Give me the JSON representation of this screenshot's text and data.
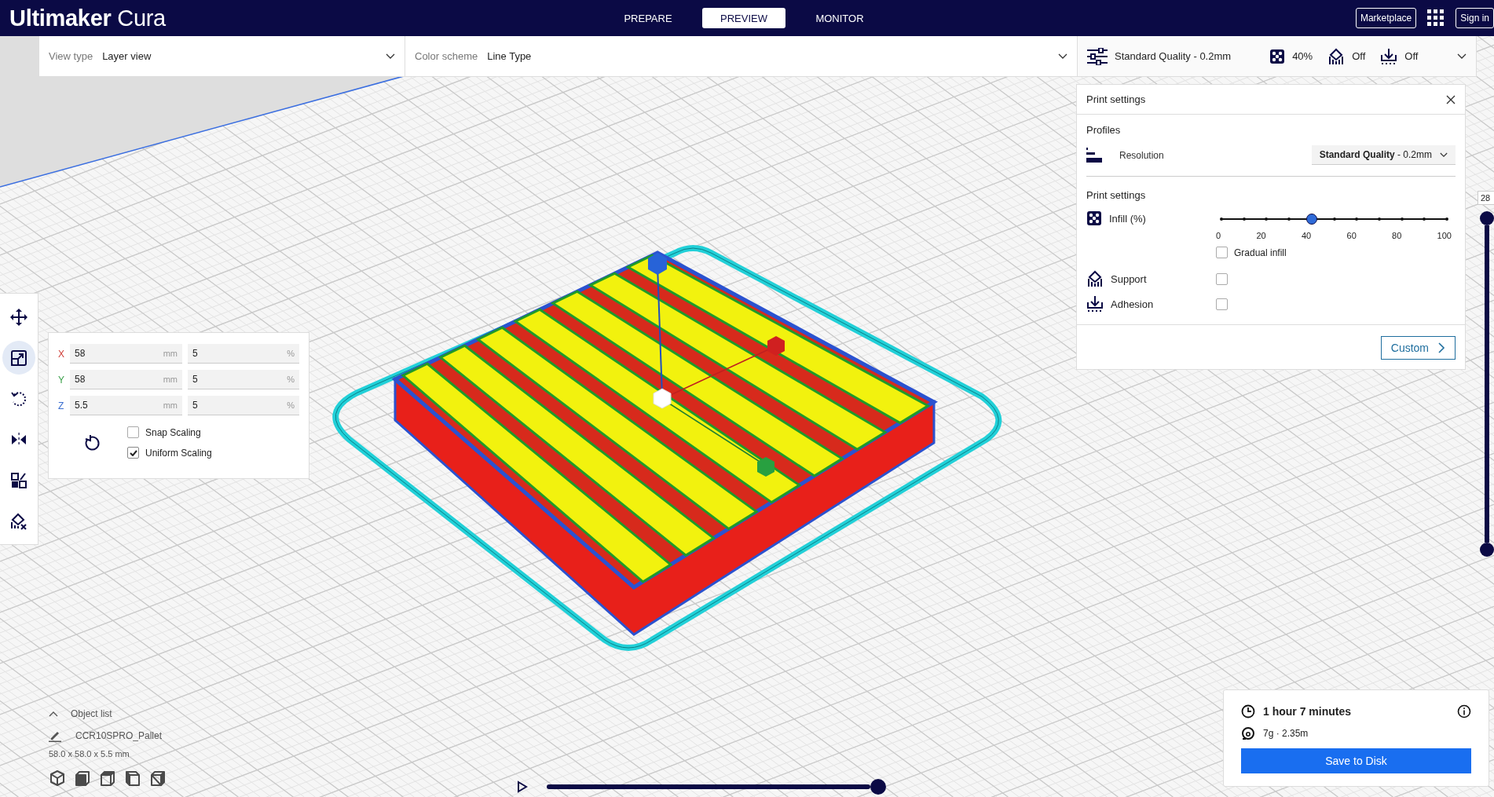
{
  "app": {
    "logo_bold": "Ultimaker",
    "logo_light": "Cura"
  },
  "stages": [
    {
      "label": "PREPARE",
      "selected": false
    },
    {
      "label": "PREVIEW",
      "selected": true
    },
    {
      "label": "MONITOR",
      "selected": false
    }
  ],
  "header_actions": {
    "marketplace": "Marketplace",
    "sign_in": "Sign in"
  },
  "view_type": {
    "label": "View type",
    "value": "Layer view"
  },
  "color_scheme": {
    "label": "Color scheme",
    "value": "Line Type"
  },
  "print_setup_summary": {
    "profile": "Standard Quality - 0.2mm",
    "infill": "40%",
    "support": "Off",
    "adhesion": "Off"
  },
  "print_settings_panel": {
    "title": "Print settings",
    "profiles_heading": "Profiles",
    "resolution_label": "Resolution",
    "resolution_value": "**Standard Quality** - 0.2mm",
    "settings_heading": "Print settings",
    "infill": {
      "label": "Infill (%)",
      "level": 0.4,
      "ticks": [
        "0",
        "20",
        "40",
        "60",
        "80",
        "100"
      ]
    },
    "gradual_infill": {
      "label": "Gradual infill",
      "checked": false
    },
    "support": {
      "label": "Support",
      "checked": false
    },
    "adhesion": {
      "label": "Adhesion",
      "checked": false
    },
    "custom_button": "Custom"
  },
  "tools": [
    {
      "kind": "move",
      "selected": false
    },
    {
      "kind": "scale",
      "selected": true
    },
    {
      "kind": "rotate",
      "selected": false
    },
    {
      "kind": "mirror",
      "selected": false
    },
    {
      "kind": "per_model",
      "selected": false
    },
    {
      "kind": "support_blocker",
      "selected": false
    }
  ],
  "scale_panel": {
    "rows": [
      {
        "axis": "X",
        "color": "#d0403a",
        "value": "58",
        "unit": "mm",
        "percent": "5",
        "percent_unit": "%"
      },
      {
        "axis": "Y",
        "color": "#3aa04a",
        "value": "58",
        "unit": "mm",
        "percent": "5",
        "percent_unit": "%"
      },
      {
        "axis": "Z",
        "color": "#3a6ed0",
        "value": "5.5",
        "unit": "mm",
        "percent": "5",
        "percent_unit": "%"
      }
    ],
    "snap_scaling": {
      "label": "Snap Scaling",
      "checked": false
    },
    "uniform_scaling": {
      "label": "Uniform Scaling",
      "checked": true
    }
  },
  "layer_slider": {
    "current_layer": "28",
    "level": 1
  },
  "object_list": {
    "toggle": "Object list",
    "item": "CCR10SPRO_Pallet",
    "dimensions": "58.0 x 58.0 x 5.5 mm"
  },
  "view_orientations": [
    {
      "kind": "isometric"
    },
    {
      "kind": "front"
    },
    {
      "kind": "top"
    },
    {
      "kind": "left"
    },
    {
      "kind": "right"
    }
  ],
  "print_info": {
    "time": "1 hour 7 minutes",
    "material": "7g · 2.35m",
    "button": "Save to Disk"
  },
  "simulation": {
    "level": 1
  }
}
